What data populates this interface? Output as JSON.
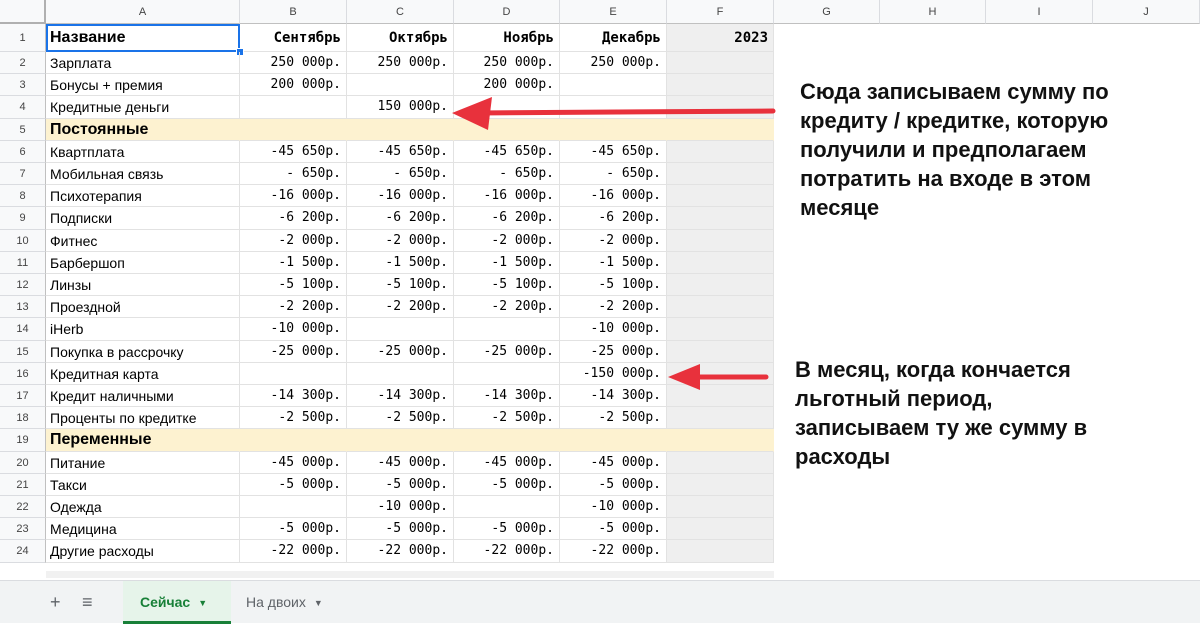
{
  "columns": [
    "A",
    "B",
    "C",
    "D",
    "E",
    "F",
    "G",
    "H",
    "I",
    "J"
  ],
  "table": {
    "header": {
      "name": "Название",
      "b": "Сентябрь",
      "c": "Октябрь",
      "d": "Ноябрь",
      "e": "Декабрь",
      "f": "2023"
    },
    "rows": [
      {
        "num": "2",
        "name": "Зарплата",
        "b": "250 000р.",
        "c": "250 000р.",
        "d": "250 000р.",
        "e": "250 000р."
      },
      {
        "num": "3",
        "name": "Бонусы + премия",
        "b": "200 000р.",
        "c": "",
        "d": "200 000р.",
        "e": ""
      },
      {
        "num": "4",
        "name": "Кредитные деньги",
        "b": "",
        "c": "150 000р.",
        "d": "",
        "e": ""
      },
      {
        "num": "5",
        "name": "Постоянные",
        "section": true
      },
      {
        "num": "6",
        "name": "Квартплата",
        "b": "-45 650р.",
        "c": "-45 650р.",
        "d": "-45 650р.",
        "e": "-45 650р."
      },
      {
        "num": "7",
        "name": "Мобильная связь",
        "b": "-  650р.",
        "c": "-  650р.",
        "d": "-  650р.",
        "e": "-  650р."
      },
      {
        "num": "8",
        "name": "Психотерапия",
        "b": "-16 000р.",
        "c": "-16 000р.",
        "d": "-16 000р.",
        "e": "-16 000р."
      },
      {
        "num": "9",
        "name": "Подписки",
        "b": "-6 200р.",
        "c": "-6 200р.",
        "d": "-6 200р.",
        "e": "-6 200р."
      },
      {
        "num": "10",
        "name": "Фитнес",
        "b": "-2 000р.",
        "c": "-2 000р.",
        "d": "-2 000р.",
        "e": "-2 000р."
      },
      {
        "num": "11",
        "name": "Барбершоп",
        "b": "-1 500р.",
        "c": "-1 500р.",
        "d": "-1 500р.",
        "e": "-1 500р."
      },
      {
        "num": "12",
        "name": "Линзы",
        "b": "-5 100р.",
        "c": "-5 100р.",
        "d": "-5 100р.",
        "e": "-5 100р."
      },
      {
        "num": "13",
        "name": "Проездной",
        "b": "-2 200р.",
        "c": "-2 200р.",
        "d": "-2 200р.",
        "e": "-2 200р."
      },
      {
        "num": "14",
        "name": "iHerb",
        "b": "-10 000р.",
        "c": "",
        "d": "",
        "e": "-10 000р."
      },
      {
        "num": "15",
        "name": "Покупка в рассрочку",
        "b": "-25 000р.",
        "c": "-25 000р.",
        "d": "-25 000р.",
        "e": "-25 000р."
      },
      {
        "num": "16",
        "name": "Кредитная карта",
        "b": "",
        "c": "",
        "d": "",
        "e": "-150 000р."
      },
      {
        "num": "17",
        "name": "Кредит наличными",
        "b": "-14 300р.",
        "c": "-14 300р.",
        "d": "-14 300р.",
        "e": "-14 300р."
      },
      {
        "num": "18",
        "name": "Проценты по кредитке",
        "b": "-2 500р.",
        "c": "-2 500р.",
        "d": "-2 500р.",
        "e": "-2 500р."
      },
      {
        "num": "19",
        "name": "Переменные",
        "section": true
      },
      {
        "num": "20",
        "name": "Питание",
        "b": "-45 000р.",
        "c": "-45 000р.",
        "d": "-45 000р.",
        "e": "-45 000р."
      },
      {
        "num": "21",
        "name": "Такси",
        "b": "-5 000р.",
        "c": "-5 000р.",
        "d": "-5 000р.",
        "e": "-5 000р."
      },
      {
        "num": "22",
        "name": "Одежда",
        "b": "",
        "c": "-10 000р.",
        "d": "",
        "e": "-10 000р."
      },
      {
        "num": "23",
        "name": "Медицина",
        "b": "-5 000р.",
        "c": "-5 000р.",
        "d": "-5 000р.",
        "e": "-5 000р."
      },
      {
        "num": "24",
        "name": "Другие расходы",
        "b": "-22 000р.",
        "c": "-22 000р.",
        "d": "-22 000р.",
        "e": "-22 000р."
      }
    ]
  },
  "annotations": {
    "credit_note": [
      "Сюда записываем сумму по",
      "кредиту / кредитке, которую",
      "получили и предполагаем",
      "потратить на входе в этом",
      "месяце"
    ],
    "grace_note": [
      "В месяц, когда кончается",
      "льготный период,",
      "записываем ту же сумму в",
      "расходы"
    ],
    "arrow_color": "#e8313c"
  },
  "tabs": {
    "add_icon": "+",
    "list_icon": "≡",
    "items": [
      {
        "label": "Сейчас",
        "active": true
      },
      {
        "label": "На двоих",
        "active": false
      }
    ]
  },
  "colors": {
    "section_bg": "#fdf2d0",
    "column_f_bg": "#efefef",
    "active_tab": "#188038",
    "selection": "#1a73e8"
  }
}
